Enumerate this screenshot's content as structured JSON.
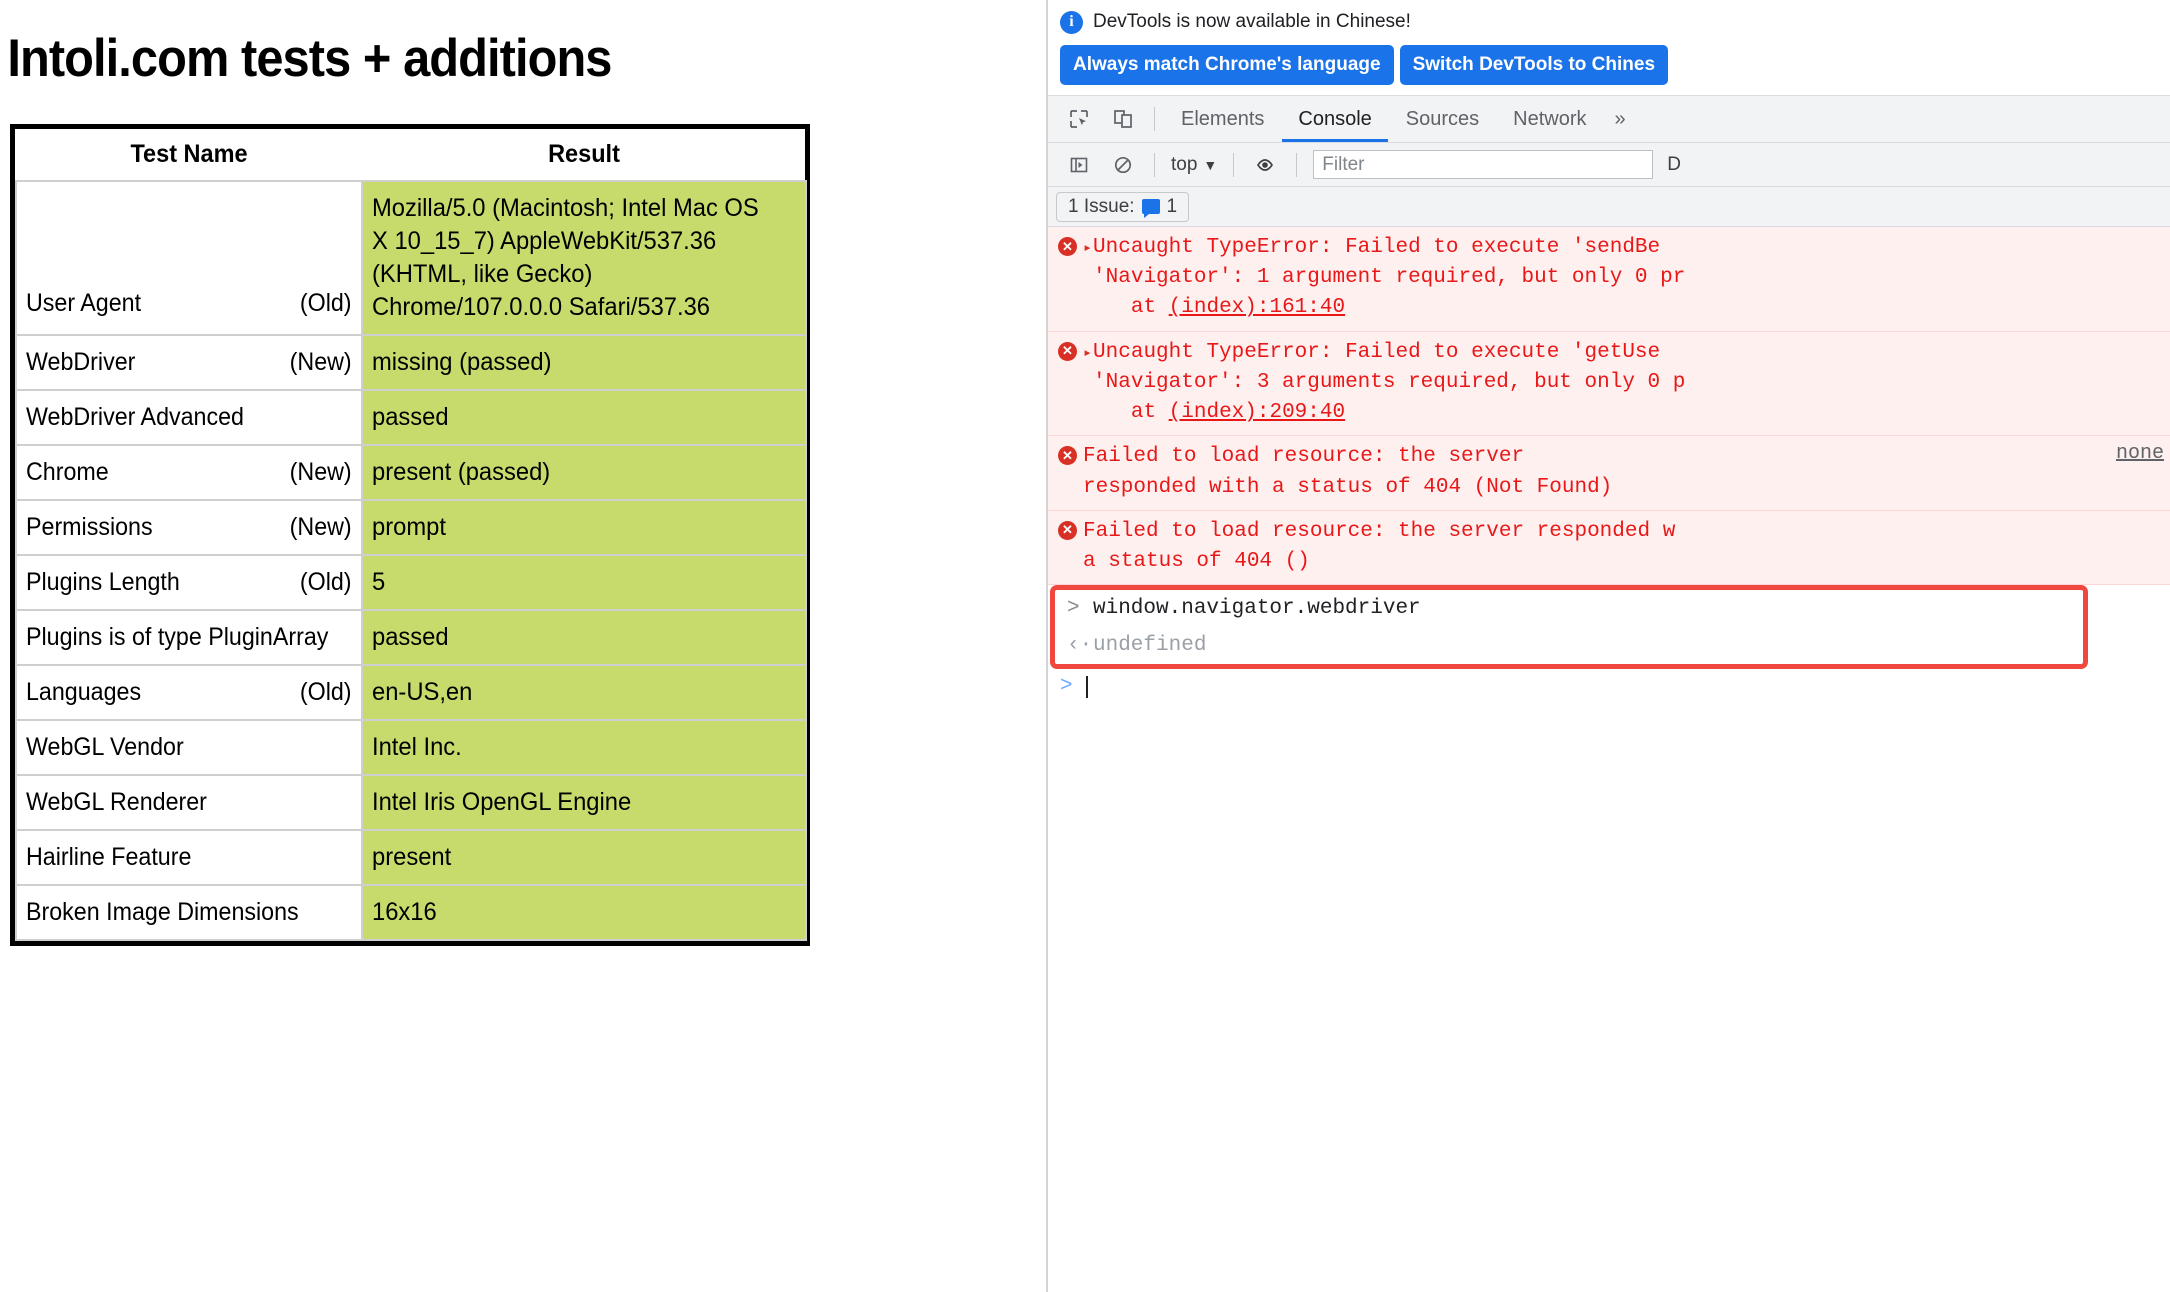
{
  "page": {
    "title": "Intoli.com tests + additions",
    "table": {
      "headers": [
        "Test Name",
        "Result"
      ],
      "rows": [
        {
          "name": "User Agent",
          "age": "(Old)",
          "result": "Mozilla/5.0 (Macintosh; Intel Mac OS X 10_15_7) AppleWebKit/537.36 (KHTML, like Gecko) Chrome/107.0.0.0 Safari/537.36"
        },
        {
          "name": "WebDriver",
          "age": "(New)",
          "result": "missing (passed)"
        },
        {
          "name": "WebDriver Advanced",
          "age": "",
          "result": "passed"
        },
        {
          "name": "Chrome",
          "age": "(New)",
          "result": "present (passed)"
        },
        {
          "name": "Permissions",
          "age": "(New)",
          "result": "prompt"
        },
        {
          "name": "Plugins Length",
          "age": "(Old)",
          "result": "5"
        },
        {
          "name": "Plugins is of type PluginArray",
          "age": "",
          "result": "passed"
        },
        {
          "name": "Languages",
          "age": "(Old)",
          "result": "en-US,en"
        },
        {
          "name": "WebGL Vendor",
          "age": "",
          "result": "Intel Inc."
        },
        {
          "name": "WebGL Renderer",
          "age": "",
          "result": "Intel Iris OpenGL Engine"
        },
        {
          "name": "Hairline Feature",
          "age": "",
          "result": "present"
        },
        {
          "name": "Broken Image Dimensions",
          "age": "",
          "result": "16x16"
        }
      ]
    }
  },
  "devtools": {
    "notice": {
      "icon": "info-icon",
      "text": "DevTools is now available in Chinese!",
      "primary_button": "Always match Chrome's language",
      "secondary_button": "Switch DevTools to Chines"
    },
    "toolbar": {
      "inspect_icon": "inspect-element-icon",
      "device_icon": "device-toolbar-icon",
      "tabs": [
        {
          "label": "Elements",
          "active": false
        },
        {
          "label": "Console",
          "active": true
        },
        {
          "label": "Sources",
          "active": false
        },
        {
          "label": "Network",
          "active": false
        }
      ],
      "overflow": "»"
    },
    "filterbar": {
      "sidebar_icon": "console-sidebar-icon",
      "clear_icon": "clear-console-icon",
      "context": "top",
      "context_chevron": "▼",
      "eye_icon": "live-expression-icon",
      "filter_placeholder": "Filter",
      "levels_label": "D"
    },
    "issues": {
      "label": "1 Issue:",
      "icon": "issues-badge-icon",
      "count": "1"
    },
    "messages": [
      {
        "icon": "error-icon",
        "expandable": true,
        "lines": [
          "Uncaught TypeError: Failed to execute 'sendBe",
          "'Navigator': 1 argument required, but only 0 pr",
          "   at (index):161:40"
        ],
        "link_line_index": 2,
        "link_text": "(index):161:40",
        "right_link": ""
      },
      {
        "icon": "error-icon",
        "expandable": true,
        "lines": [
          "Uncaught TypeError: Failed to execute 'getUse",
          "'Navigator': 3 arguments required, but only 0 p",
          "   at (index):209:40"
        ],
        "link_line_index": 2,
        "link_text": "(index):209:40",
        "right_link": ""
      },
      {
        "icon": "error-icon",
        "expandable": false,
        "lines": [
          "Failed to load resource: the server",
          "responded with a status of 404 (Not Found)"
        ],
        "link_line_index": -1,
        "link_text": "",
        "right_link": "none"
      },
      {
        "icon": "error-icon",
        "expandable": false,
        "lines": [
          "Failed to load resource: the server responded w",
          "a status of 404 ()"
        ],
        "link_line_index": -1,
        "link_text": "",
        "right_link": ""
      }
    ],
    "command": {
      "input_arrow": ">",
      "input_text": "window.navigator.webdriver",
      "output_arrow": "‹·",
      "output_text": "undefined"
    },
    "prompt": {
      "arrow": ">"
    },
    "colors": {
      "accent_blue": "#1a73e8",
      "error_red": "#e81818",
      "error_bg": "#fff0f0",
      "highlight_box": "#f0483e",
      "pass_green": "#c7da6c",
      "toolbar_bg": "#f1f3f4"
    }
  }
}
